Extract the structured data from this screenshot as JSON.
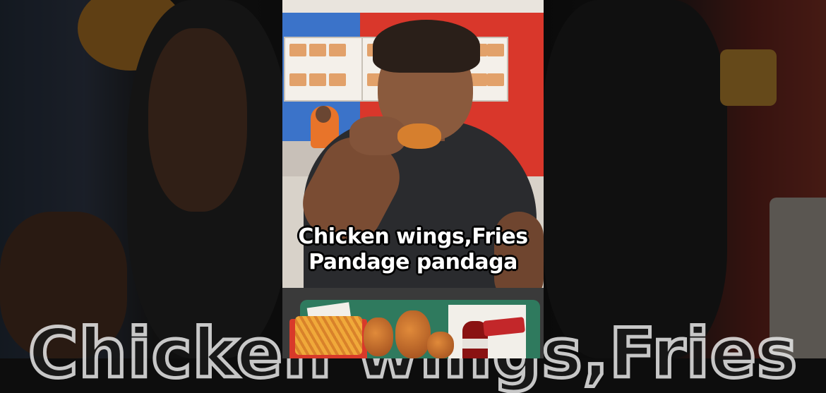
{
  "caption": {
    "line1": "Chicken wings,Fries",
    "line2": "Pandage pandaga"
  },
  "background_caption": "Chicken wings,Fries"
}
